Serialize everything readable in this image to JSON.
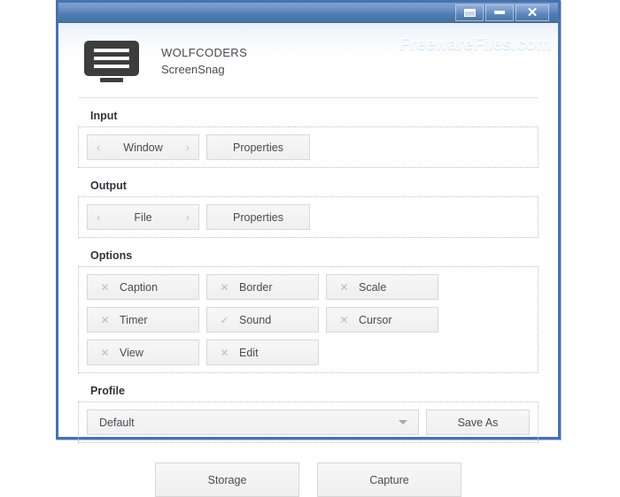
{
  "window": {
    "controls": [
      {
        "name": "restore",
        "label": "Restore"
      },
      {
        "name": "minimize",
        "label": "Minimize"
      },
      {
        "name": "close",
        "label": "✕"
      }
    ]
  },
  "watermark": "FreewareFiles.com",
  "header": {
    "brand": "WOLFCODERS",
    "product": "ScreenSnag",
    "logo_icon": "monitor-icon"
  },
  "sections": {
    "input": {
      "label": "Input",
      "spinner": {
        "prev_icon": "‹",
        "value": "Window",
        "next_icon": "›"
      },
      "properties_label": "Properties"
    },
    "output": {
      "label": "Output",
      "spinner": {
        "prev_icon": "‹",
        "value": "File",
        "next_icon": "›"
      },
      "properties_label": "Properties"
    },
    "options": {
      "label": "Options",
      "items": [
        {
          "label": "Caption",
          "mark": "✕",
          "state": "off"
        },
        {
          "label": "Border",
          "mark": "✕",
          "state": "off"
        },
        {
          "label": "Scale",
          "mark": "✕",
          "state": "off"
        },
        {
          "label": "Timer",
          "mark": "✕",
          "state": "off"
        },
        {
          "label": "Sound",
          "mark": "✓",
          "state": "on"
        },
        {
          "label": "Cursor",
          "mark": "✕",
          "state": "off"
        },
        {
          "label": "View",
          "mark": "✕",
          "state": "off"
        },
        {
          "label": "Edit",
          "mark": "✕",
          "state": "off"
        }
      ]
    },
    "profile": {
      "label": "Profile",
      "selected": "Default",
      "save_as_label": "Save As"
    }
  },
  "footer": {
    "storage_label": "Storage",
    "capture_label": "Capture"
  },
  "colors": {
    "titlebar_blue": "#4f7bb5",
    "window_border": "#4872ad",
    "button_face": "#f0f0f0",
    "text": "#4a4a55"
  }
}
